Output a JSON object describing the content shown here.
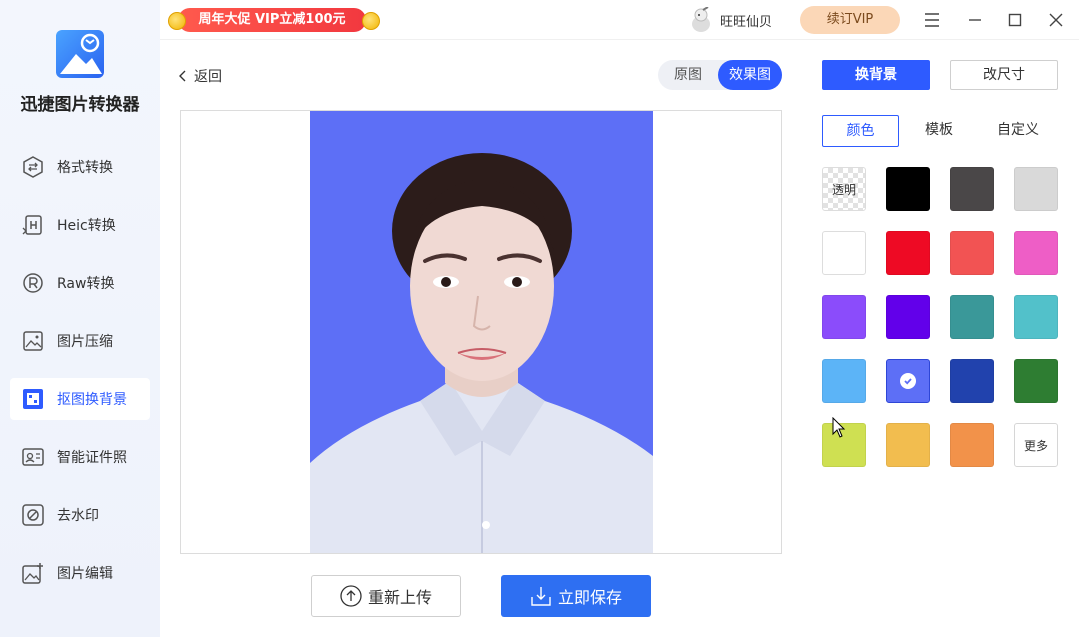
{
  "app": {
    "name": "迅捷图片转换器"
  },
  "sidebar": {
    "items": [
      {
        "label": "格式转换",
        "icon": "format-convert-icon",
        "active": false
      },
      {
        "label": "Heic转换",
        "icon": "heic-icon",
        "active": false
      },
      {
        "label": "Raw转换",
        "icon": "raw-icon",
        "active": false
      },
      {
        "label": "图片压缩",
        "icon": "image-compress-icon",
        "active": false
      },
      {
        "label": "抠图换背景",
        "icon": "cutout-icon",
        "active": true
      },
      {
        "label": "智能证件照",
        "icon": "id-photo-icon",
        "active": false
      },
      {
        "label": "去水印",
        "icon": "remove-watermark-icon",
        "active": false
      },
      {
        "label": "图片编辑",
        "icon": "image-edit-icon",
        "active": false
      }
    ]
  },
  "topbar": {
    "promo": "周年大促 VIP立减100元",
    "username": "旺旺仙贝",
    "vip_button": "续订VIP"
  },
  "content": {
    "back": "返回",
    "toggle": {
      "original": "原图",
      "result": "效果图",
      "selected": "result"
    },
    "reupload": "重新上传",
    "save": "立即保存",
    "background_color": "#5d6ff6"
  },
  "panel": {
    "tab_background": "换背景",
    "tab_resize": "改尺寸",
    "subtabs": {
      "color": "颜色",
      "template": "模板",
      "custom": "自定义"
    },
    "transparent_label": "透明",
    "more_label": "更多",
    "colors": [
      "#000000",
      "#4a4748",
      "#d9d9d9",
      "#ffffff",
      "#ee0a24",
      "#f25353",
      "#ee5ec6",
      "#8b4cfb",
      "#6200ea",
      "#3a9899",
      "#52c1ca",
      "#5cb4f7",
      "#5d6ff6",
      "#2142ad",
      "#2e7d32",
      "#cfe052",
      "#f2bd4f",
      "#f2924a"
    ],
    "selected_color": "#5d6ff6"
  }
}
